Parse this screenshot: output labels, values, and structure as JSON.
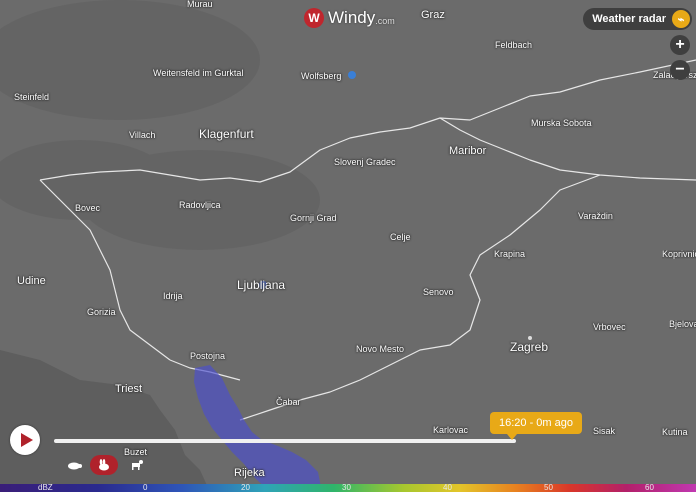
{
  "app": {
    "logo_glyph": "W",
    "logo_text": "Windy",
    "logo_suffix": ".com"
  },
  "overlay_button": {
    "label": "Weather radar",
    "icon": "radar-icon"
  },
  "zoom": {
    "in_label": "+",
    "out_label": "−"
  },
  "timeline": {
    "current_label": "16:20 - 0m ago",
    "progress": 1.0,
    "play_icon": "play-icon",
    "speed_options": [
      "turtle-icon",
      "rabbit-icon",
      "goat-icon"
    ],
    "selected_speed": "rabbit-icon"
  },
  "legend": {
    "unit": "dBZ",
    "ticks": [
      "0",
      "20",
      "30",
      "40",
      "50",
      "60"
    ]
  },
  "places": [
    {
      "name": "Murau"
    },
    {
      "name": "Graz"
    },
    {
      "name": "Feldbach"
    },
    {
      "name": "Weitensfeld im Gurktal"
    },
    {
      "name": "Wolfsberg"
    },
    {
      "name": "Zalaegerszeg"
    },
    {
      "name": "Steinfeld"
    },
    {
      "name": "Villach"
    },
    {
      "name": "Klagenfurt"
    },
    {
      "name": "Murska Sobota"
    },
    {
      "name": "Maribor"
    },
    {
      "name": "Slovenj Gradec"
    },
    {
      "name": "Bovec"
    },
    {
      "name": "Radovljica"
    },
    {
      "name": "Gornji Grad"
    },
    {
      "name": "Varaždin"
    },
    {
      "name": "Celje"
    },
    {
      "name": "Krapina"
    },
    {
      "name": "Koprivnica"
    },
    {
      "name": "Udine"
    },
    {
      "name": "Idrija"
    },
    {
      "name": "Ljubljana"
    },
    {
      "name": "Senovo"
    },
    {
      "name": "Gorizia"
    },
    {
      "name": "Vrbovec"
    },
    {
      "name": "Bjelovar"
    },
    {
      "name": "Postojna"
    },
    {
      "name": "Novo Mesto"
    },
    {
      "name": "Zagreb"
    },
    {
      "name": "Triest"
    },
    {
      "name": "Čabar"
    },
    {
      "name": "Karlovac"
    },
    {
      "name": "Sisak"
    },
    {
      "name": "Kutina"
    },
    {
      "name": "Buzet"
    },
    {
      "name": "Rijeka"
    }
  ],
  "colors": {
    "map_bg": "#6b6b6b",
    "brand_red": "#c0262d",
    "accent_orange": "#e8a917",
    "radar_blue": "#4b4fd0"
  }
}
